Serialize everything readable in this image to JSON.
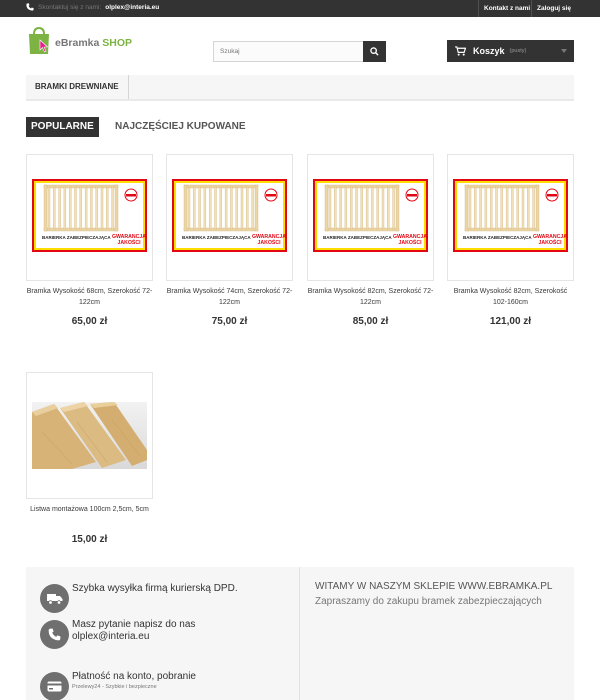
{
  "topbar": {
    "contact_prefix": "Skontaktuj się z nami:",
    "email": "olplex@interia.eu",
    "contact_link": "Kontakt z nami",
    "login_link": "Zaloguj się"
  },
  "header": {
    "logo_text_a": "eBramka",
    "logo_text_b": "SHOP",
    "search_placeholder": "Szukaj",
    "cart_label": "Koszyk",
    "cart_status": "(pusty)"
  },
  "nav": {
    "items": [
      "BRAMKI DREWNIANE"
    ]
  },
  "tabs": [
    "POPULARNE",
    "NAJCZĘŚCIEJ KUPOWANE"
  ],
  "gate_image_text": {
    "caption": "BARIERKA ZABEZPIECZAJĄCA",
    "guarantee_line1": "GWARANCJA",
    "guarantee_line2": "JAKOŚCI"
  },
  "products": [
    {
      "name": "Bramka Wysokość 68cm, Szerokość 72-122cm",
      "price": "65,00 zł",
      "image": "safety-gate"
    },
    {
      "name": "Bramka Wysokość 74cm, Szerokość 72-122cm",
      "price": "75,00 zł",
      "image": "safety-gate"
    },
    {
      "name": "Bramka Wysokość 82cm, Szerokość 72-122cm",
      "price": "85,00 zł",
      "image": "safety-gate"
    },
    {
      "name": "Bramka Wysokość 82cm, Szerokość 102-160cm",
      "price": "121,00 zł",
      "image": "safety-gate"
    },
    {
      "name": "Listwa montażowa 100cm 2,5cm, 5cm",
      "price": "15,00 zł",
      "image": "wooden-planks"
    }
  ],
  "footer": {
    "shipping": "Szybka wysyłka firmą kurierską DPD.",
    "question_title": "Masz pytanie napisz do nas olplex@interia.eu",
    "payment_title": "Płatność na konto, pobranie",
    "payment_sub": "Przelewy24 - Szybkie i bezpieczne",
    "welcome_title": "WITAMY W NASZYM SKLEPIE WWW.EBRAMKA.PL",
    "welcome_text": "Zapraszamy do zakupu bramek zabezpieczających"
  },
  "colors": {
    "dark": "#333333",
    "brand_green": "#7cb342",
    "gate_border_red": "#e30613",
    "gate_frame_yellow": "#ffdd00"
  }
}
